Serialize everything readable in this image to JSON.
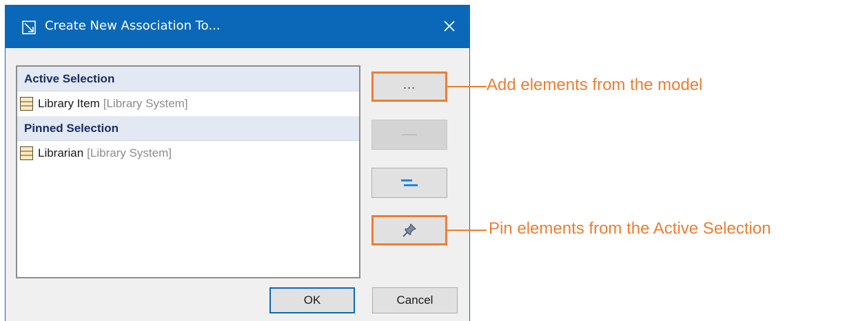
{
  "dialog": {
    "title": "Create New Association To...",
    "title_icon": "association-icon",
    "close_icon": "close-icon"
  },
  "list": {
    "active_header": "Active Selection",
    "active_items": [
      {
        "name": "Library Item",
        "owner": "[Library System]",
        "icon": "class-icon"
      }
    ],
    "pinned_header": "Pinned Selection",
    "pinned_items": [
      {
        "name": "Librarian",
        "owner": "[Library System]",
        "icon": "class-icon"
      }
    ]
  },
  "side_buttons": {
    "more_label": "...",
    "remove_icon": "minus-icon",
    "equal_icon": "equal-icon",
    "pin_icon": "pin-icon"
  },
  "buttons": {
    "ok_label": "OK",
    "cancel_label": "Cancel"
  },
  "callouts": {
    "add": "Add elements from the model",
    "pin": "Pin elements from the Active Selection"
  },
  "colors": {
    "titlebar": "#0b68b9",
    "callout": "#ed7d31",
    "section_header_bg": "#e3e9f2",
    "section_header_text": "#1a2d66",
    "equal_icon": "#1e88e5"
  }
}
